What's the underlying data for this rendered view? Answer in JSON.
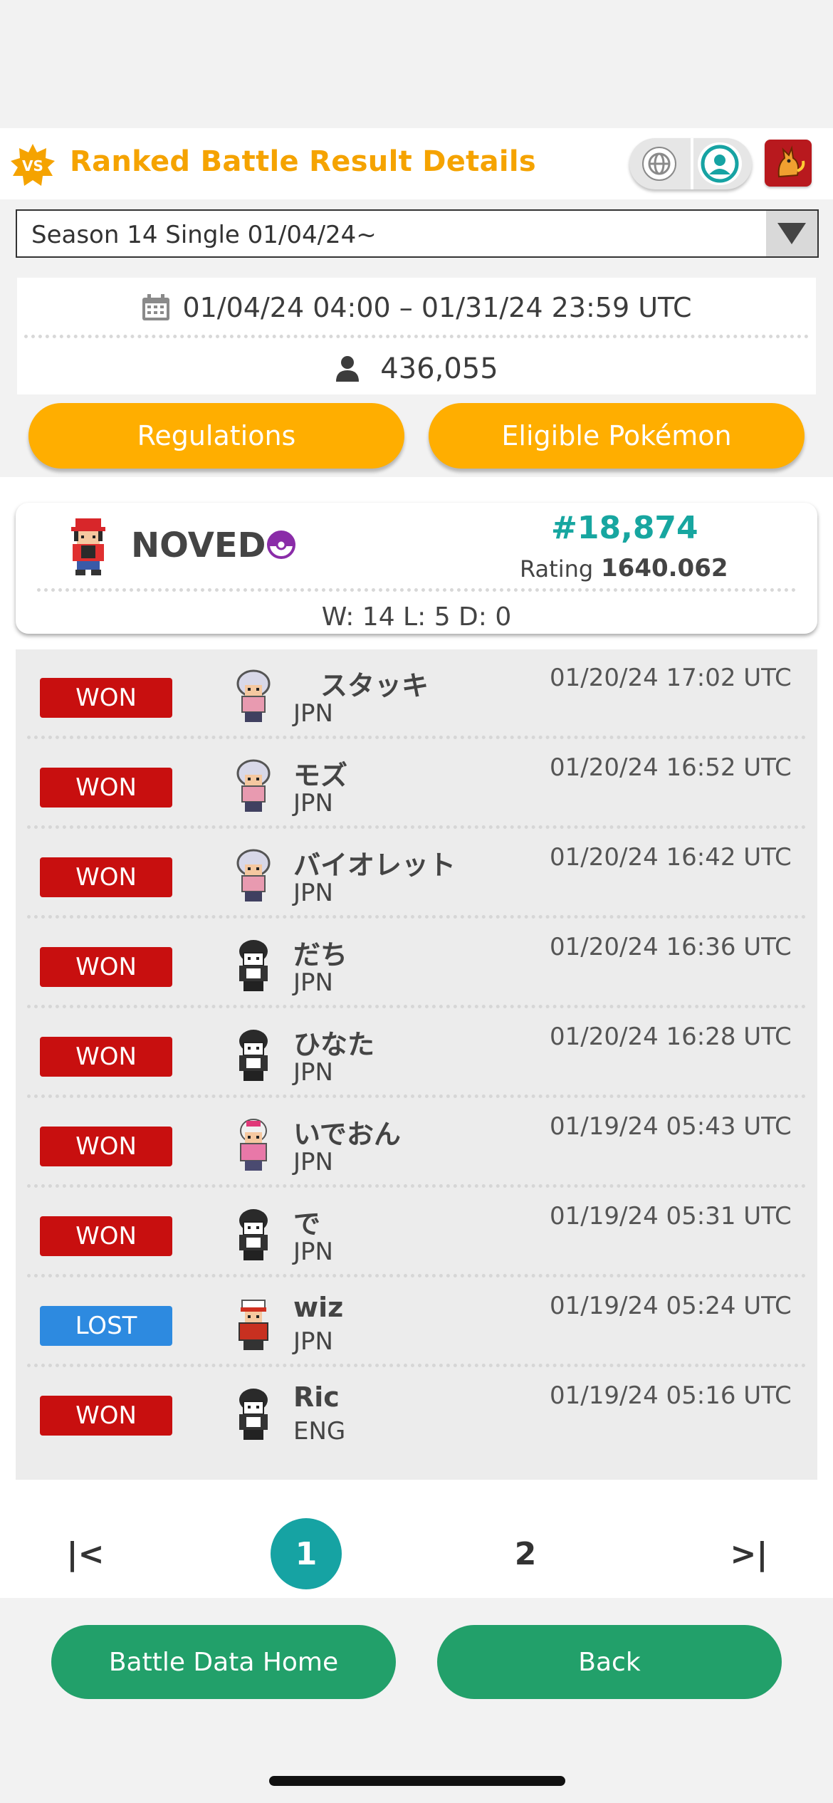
{
  "header": {
    "title": "Ranked Battle Result Details",
    "badge_text": "VS"
  },
  "season_select": {
    "value": "Season 14 Single 01/04/24~"
  },
  "season_info": {
    "period": "01/04/24 04:00 – 01/31/24 23:59 UTC",
    "participants": "436,055"
  },
  "buttons": {
    "regulations": "Regulations",
    "eligible": "Eligible Pokémon",
    "home": "Battle Data Home",
    "back": "Back"
  },
  "player": {
    "name": "NOVED",
    "rank": "#18,874",
    "rating_label": "Rating",
    "rating_value": "1640.062",
    "record": "W: 14 L: 5 D: 0"
  },
  "battles": [
    {
      "result": "WON",
      "name": "　スタッキ",
      "country": "JPN",
      "time": "01/20/24 17:02 UTC",
      "sprite": "trainer-girl-icon"
    },
    {
      "result": "WON",
      "name": "モズ",
      "country": "JPN",
      "time": "01/20/24 16:52 UTC",
      "sprite": "trainer-girl-icon"
    },
    {
      "result": "WON",
      "name": "バイオレット",
      "country": "JPN",
      "time": "01/20/24 16:42 UTC",
      "sprite": "trainer-girl-icon"
    },
    {
      "result": "WON",
      "name": "だち",
      "country": "JPN",
      "time": "01/20/24 16:36 UTC",
      "sprite": "trainer-dark-icon"
    },
    {
      "result": "WON",
      "name": "ひなた",
      "country": "JPN",
      "time": "01/20/24 16:28 UTC",
      "sprite": "trainer-dark-icon"
    },
    {
      "result": "WON",
      "name": "いでおん",
      "country": "JPN",
      "time": "01/19/24 05:43 UTC",
      "sprite": "trainer-pink-icon"
    },
    {
      "result": "WON",
      "name": "で",
      "country": "JPN",
      "time": "01/19/24 05:31 UTC",
      "sprite": "trainer-dark-icon"
    },
    {
      "result": "LOST",
      "name": "wiz",
      "country": "JPN",
      "time": "01/19/24 05:24 UTC",
      "sprite": "trainer-red-icon"
    },
    {
      "result": "WON",
      "name": "Ric",
      "country": "ENG",
      "time": "01/19/24 05:16 UTC",
      "sprite": "trainer-dark-icon"
    }
  ],
  "pager": {
    "first": "|<",
    "current": "1",
    "next_page": "2",
    "last": ">|"
  },
  "colors": {
    "accent_orange": "#f5a300",
    "teal": "#16a3a3",
    "won": "#c80f0f",
    "lost": "#2d8ae0",
    "green": "#22a06a"
  }
}
